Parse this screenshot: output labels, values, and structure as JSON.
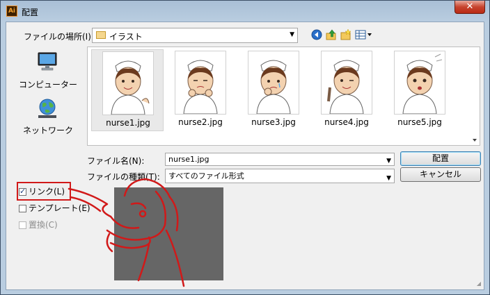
{
  "window": {
    "app_icon_text": "Ai",
    "title": "配置",
    "close_label": "✕"
  },
  "lookin": {
    "label": "ファイルの場所(I):",
    "value": "イラスト"
  },
  "toolbar": {
    "icons": [
      "back-icon",
      "up-folder-icon",
      "new-folder-icon",
      "view-menu-icon"
    ]
  },
  "places": [
    {
      "label": "コンピューター",
      "icon": "computer-icon"
    },
    {
      "label": "ネットワーク",
      "icon": "network-icon"
    }
  ],
  "files": [
    {
      "name": "nurse1.jpg",
      "selected": true
    },
    {
      "name": "nurse2.jpg",
      "selected": false
    },
    {
      "name": "nurse3.jpg",
      "selected": false
    },
    {
      "name": "nurse4.jpg",
      "selected": false
    },
    {
      "name": "nurse5.jpg",
      "selected": false
    }
  ],
  "filename": {
    "label": "ファイル名(N):",
    "value": "nurse1.jpg"
  },
  "filetype": {
    "label": "ファイルの種類(T):",
    "value": "すべてのファイル形式"
  },
  "buttons": {
    "place": "配置",
    "cancel": "キャンセル"
  },
  "options": [
    {
      "label": "リンク(L)",
      "checked": true,
      "disabled": false
    },
    {
      "label": "テンプレート(E)",
      "checked": false,
      "disabled": false
    },
    {
      "label": "置換(C)",
      "checked": false,
      "disabled": true
    }
  ],
  "colors": {
    "annotation_red": "#d11919",
    "preview_gray": "#666666"
  }
}
